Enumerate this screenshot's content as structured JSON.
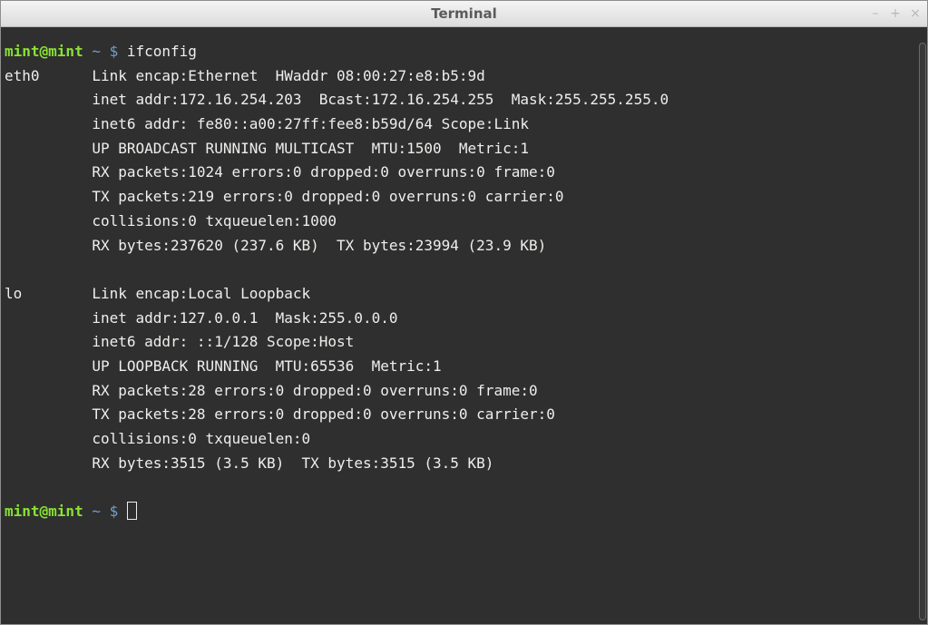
{
  "window": {
    "title": "Terminal",
    "controls": {
      "minimize": "–",
      "maximize": "+",
      "close": "×"
    }
  },
  "colors": {
    "terminal_bg": "#2f2f2f",
    "text": "#eeeeec",
    "prompt_user": "#8ae234",
    "prompt_path": "#729fcf"
  },
  "terminal": {
    "prompt1": {
      "user": "mint@mint",
      "path": " ~ $",
      "command": " ifconfig"
    },
    "output": [
      "eth0      Link encap:Ethernet  HWaddr 08:00:27:e8:b5:9d",
      "          inet addr:172.16.254.203  Bcast:172.16.254.255  Mask:255.255.255.0",
      "          inet6 addr: fe80::a00:27ff:fee8:b59d/64 Scope:Link",
      "          UP BROADCAST RUNNING MULTICAST  MTU:1500  Metric:1",
      "          RX packets:1024 errors:0 dropped:0 overruns:0 frame:0",
      "          TX packets:219 errors:0 dropped:0 overruns:0 carrier:0",
      "          collisions:0 txqueuelen:1000",
      "          RX bytes:237620 (237.6 KB)  TX bytes:23994 (23.9 KB)",
      "",
      "lo        Link encap:Local Loopback",
      "          inet addr:127.0.0.1  Mask:255.0.0.0",
      "          inet6 addr: ::1/128 Scope:Host",
      "          UP LOOPBACK RUNNING  MTU:65536  Metric:1",
      "          RX packets:28 errors:0 dropped:0 overruns:0 frame:0",
      "          TX packets:28 errors:0 dropped:0 overruns:0 carrier:0",
      "          collisions:0 txqueuelen:0",
      "          RX bytes:3515 (3.5 KB)  TX bytes:3515 (3.5 KB)",
      ""
    ],
    "prompt2": {
      "user": "mint@mint",
      "path": " ~ $",
      "command": " "
    }
  }
}
